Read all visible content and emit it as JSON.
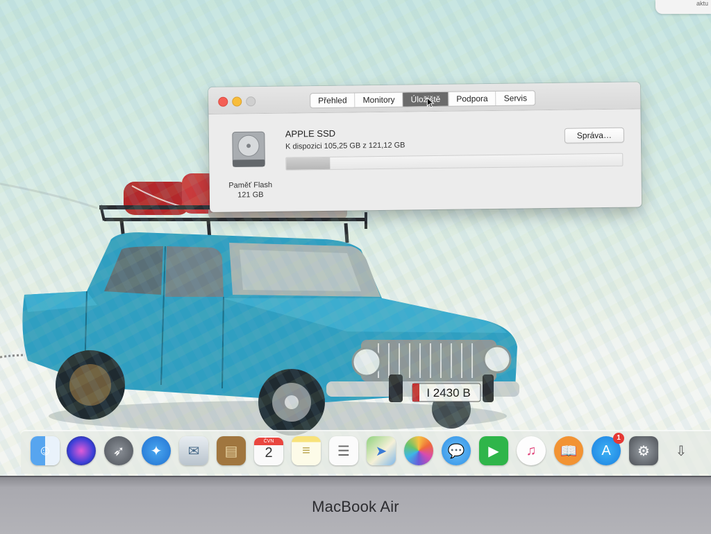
{
  "notification": {
    "text": "aktu"
  },
  "window": {
    "tabs": [
      {
        "label": "Přehled",
        "active": false
      },
      {
        "label": "Monitory",
        "active": false
      },
      {
        "label": "Úložiště",
        "active": true
      },
      {
        "label": "Podpora",
        "active": false
      },
      {
        "label": "Servis",
        "active": false
      }
    ],
    "disk": {
      "icon": "hard-drive-icon",
      "type_label": "Paměť Flash",
      "size_label": "121 GB",
      "name": "APPLE SSD",
      "availability": "K dispozici 105,25 GB z 121,12 GB",
      "used_fraction": 0.13,
      "manage_label": "Správa…"
    }
  },
  "dock": {
    "items": [
      {
        "name": "finder-icon"
      },
      {
        "name": "siri-icon"
      },
      {
        "name": "launchpad-icon"
      },
      {
        "name": "safari-icon"
      },
      {
        "name": "mail-icon"
      },
      {
        "name": "notes-book-icon"
      },
      {
        "name": "calendar-icon",
        "month": "ČVN",
        "day": "2"
      },
      {
        "name": "notes-icon"
      },
      {
        "name": "reminders-icon"
      },
      {
        "name": "maps-icon"
      },
      {
        "name": "photos-icon"
      },
      {
        "name": "messages-icon"
      },
      {
        "name": "facetime-icon"
      },
      {
        "name": "itunes-icon"
      },
      {
        "name": "books-icon"
      },
      {
        "name": "app-store-icon",
        "badge": "1"
      },
      {
        "name": "system-preferences-icon"
      },
      {
        "name": "downloads-icon"
      }
    ]
  },
  "license_plate": "I 2430 B",
  "laptop_brand": "MacBook Air"
}
